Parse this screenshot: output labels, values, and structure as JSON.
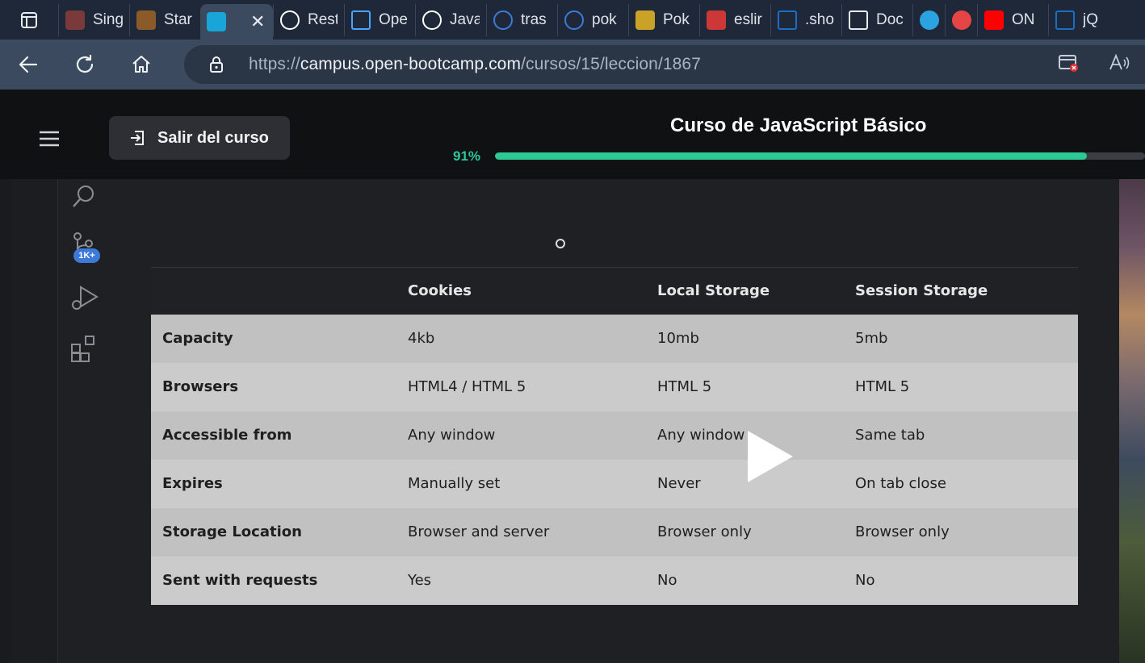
{
  "browser": {
    "tabs": [
      {
        "label": "Sing",
        "icon": "avatar-icon",
        "color": "#7a3a3a"
      },
      {
        "label": "Star",
        "icon": "ecma-icon",
        "color": "#8a5a2a"
      },
      {
        "label": "",
        "icon": "tab-app-icon",
        "color": "#1aa5d8",
        "active": true
      },
      {
        "label": "Rest",
        "icon": "github-icon",
        "color": "#ffffff"
      },
      {
        "label": "Ope",
        "icon": "window-icon",
        "color": "#4aa3ff"
      },
      {
        "label": "Java",
        "icon": "github-icon",
        "color": "#ffffff"
      },
      {
        "label": "tras",
        "icon": "search-icon",
        "color": "#3d7ad8"
      },
      {
        "label": "pok",
        "icon": "search-icon",
        "color": "#3d7ad8"
      },
      {
        "label": "Pok",
        "icon": "pokemon-icon",
        "color": "#c9a227"
      },
      {
        "label": "eslir",
        "icon": "npm-icon",
        "color": "#cb3837"
      },
      {
        "label": ".sho",
        "icon": "jquery-icon",
        "color": "#1a6fc4"
      },
      {
        "label": "Doc",
        "icon": "document-icon",
        "color": "#e8ecf2"
      },
      {
        "label": "",
        "icon": "telegram-icon",
        "color": "#2aa3e0"
      },
      {
        "label": "",
        "icon": "record-icon",
        "color": "#e64545"
      },
      {
        "label": "ON",
        "icon": "youtube-icon",
        "color": "#ff0000"
      },
      {
        "label": "jQu",
        "icon": "jquery-icon",
        "color": "#1a6fc4"
      }
    ],
    "url": {
      "scheme": "https://",
      "host": "campus.open-bootcamp.com",
      "path": "/cursos/15/leccion/1867"
    }
  },
  "course": {
    "exit_label": "Salir del curso",
    "title": "Curso de JavaScript Básico",
    "progress_label": "91%",
    "progress_value": 0.91,
    "accent": "#2cc995"
  },
  "video": {
    "badge": "1K+",
    "table": {
      "headers": [
        "",
        "Cookies",
        "Local Storage",
        "Session Storage"
      ],
      "rows": [
        [
          "Capacity",
          "4kb",
          "10mb",
          "5mb"
        ],
        [
          "Browsers",
          "HTML4 / HTML 5",
          "HTML 5",
          "HTML 5"
        ],
        [
          "Accessible from",
          "Any window",
          "Any window",
          "Same tab"
        ],
        [
          "Expires",
          "Manually set",
          "Never",
          "On tab close"
        ],
        [
          "Storage Location",
          "Browser and server",
          "Browser only",
          "Browser only"
        ],
        [
          "Sent with requests",
          "Yes",
          "No",
          "No"
        ]
      ]
    }
  }
}
